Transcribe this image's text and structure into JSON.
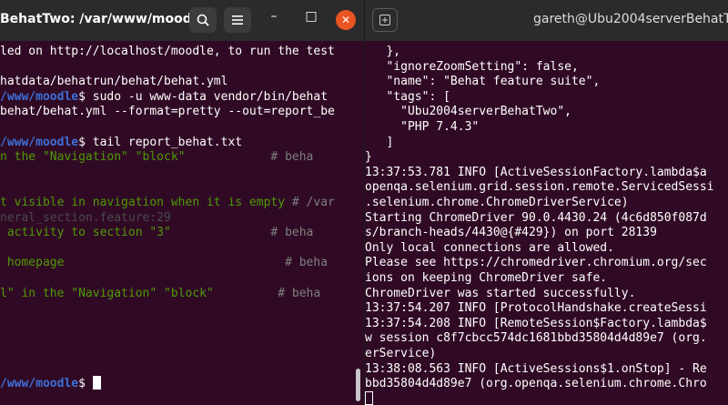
{
  "left_window": {
    "title": "BehatTwo: /var/www/moodle",
    "search_icon": "search-icon",
    "menu_icon": "hamburger-menu-icon",
    "minimize_label": "–",
    "maximize_label": "□",
    "close_label": "✕",
    "lines": [
      [
        {
          "t": "led on http://localhost/moodle, to run the test",
          "c": "white"
        }
      ],
      [
        {
          "t": "",
          "c": "white"
        }
      ],
      [
        {
          "t": "hatdata/behatrun/behat/behat.yml",
          "c": "white"
        }
      ],
      [
        {
          "t": "/www/moodle",
          "c": "blue"
        },
        {
          "t": "$ sudo -u www-data vendor/bin/behat",
          "c": "white"
        }
      ],
      [
        {
          "t": "behat/behat.yml --format=pretty --out=report_be",
          "c": "white"
        }
      ],
      [
        {
          "t": "",
          "c": "white"
        }
      ],
      [
        {
          "t": "/www/moodle",
          "c": "blue"
        },
        {
          "t": "$ tail report_behat.txt",
          "c": "white"
        }
      ],
      [
        {
          "t": "n the \"Navigation\" \"block\"",
          "c": "green"
        },
        {
          "t": "            # beha",
          "c": "gray"
        }
      ],
      [
        {
          "t": "",
          "c": "white"
        }
      ],
      [
        {
          "t": "",
          "c": "white"
        }
      ],
      [
        {
          "t": "t visible in navigation when it is empty",
          "c": "green"
        },
        {
          "t": " # /var",
          "c": "gray"
        }
      ],
      [
        {
          "t": "neral_section.feature:29",
          "c": "dim"
        }
      ],
      [
        {
          "t": " activity to section \"3\"",
          "c": "green"
        },
        {
          "t": "              # beha",
          "c": "gray"
        }
      ],
      [
        {
          "t": "",
          "c": "white"
        }
      ],
      [
        {
          "t": " homepage",
          "c": "green"
        },
        {
          "t": "                               # beha",
          "c": "gray"
        }
      ],
      [
        {
          "t": "",
          "c": "white"
        }
      ],
      [
        {
          "t": "l\" in the \"Navigation\" \"block\"",
          "c": "green"
        },
        {
          "t": "         # beha",
          "c": "gray"
        }
      ],
      [
        {
          "t": "",
          "c": "white"
        }
      ],
      [
        {
          "t": "",
          "c": "white"
        }
      ],
      [
        {
          "t": "",
          "c": "white"
        }
      ],
      [
        {
          "t": "",
          "c": "white"
        }
      ],
      [
        {
          "t": "",
          "c": "white"
        }
      ],
      [
        {
          "t": "/www/moodle",
          "c": "blue"
        },
        {
          "t": "$ ",
          "c": "white"
        }
      ]
    ]
  },
  "right_window": {
    "title": "gareth@Ubu2004serverBehatTwo",
    "new_tab_icon": "new-tab-icon",
    "lines": [
      "   },",
      "   \"ignoreZoomSetting\": false,",
      "   \"name\": \"Behat feature suite\",",
      "   \"tags\": [",
      "     \"Ubu2004serverBehatTwo\",",
      "     \"PHP 7.4.3\"",
      "   ]",
      "}",
      "13:37:53.781 INFO [ActiveSessionFactory.lambda$a",
      "openqa.selenium.grid.session.remote.ServicedSessi",
      ".selenium.chrome.ChromeDriverService)",
      "Starting ChromeDriver 90.0.4430.24 (4c6d850f087d",
      "s/branch-heads/4430@{#429}) on port 28139",
      "Only local connections are allowed.",
      "Please see https://chromedriver.chromium.org/sec",
      "ions on keeping ChromeDriver safe.",
      "ChromeDriver was started successfully.",
      "13:37:54.207 INFO [ProtocolHandshake.createSessi",
      "13:37:54.208 INFO [RemoteSession$Factory.lambda$",
      "w session c8f7cbcc574dc1681bbd35804d4d89e7 (org.",
      "erService)",
      "13:38:08.563 INFO [ActiveSessions$1.onStop] - Re",
      "bbd35804d4d89e7 (org.openqa.selenium.chrome.Chro",
      ""
    ]
  },
  "colors": {
    "terminal_bg": "#300a24",
    "titlebar_bg": "#2b2b2b",
    "prompt_blue": "#3d6fd8",
    "step_green": "#4e9a06",
    "comment_gray": "#7f7f7f",
    "close_orange": "#e95420"
  }
}
